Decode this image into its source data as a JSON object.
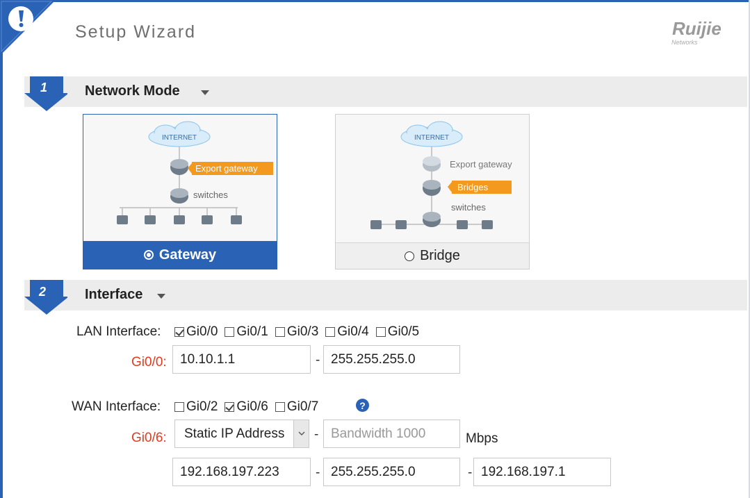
{
  "header": {
    "title": "Setup Wizard",
    "logo_text": "Ruijie",
    "logo_subtext": "Networks",
    "accent": "#2a63b6"
  },
  "section1": {
    "step": "1",
    "title": "Network Mode"
  },
  "section2": {
    "step": "2",
    "title": "Interface"
  },
  "modes": {
    "gateway": {
      "label": "Gateway",
      "selected": true,
      "diagram": {
        "cloud": "INTERNET",
        "export_gateway": "Export gateway",
        "switches": "switches"
      }
    },
    "bridge": {
      "label": "Bridge",
      "selected": false,
      "diagram": {
        "cloud": "INTERNET",
        "export_gateway": "Export gateway",
        "bridges": "Bridges",
        "switches": "switches"
      }
    }
  },
  "lan": {
    "label": "LAN Interface:",
    "ports": [
      {
        "name": "Gi0/0",
        "checked": true
      },
      {
        "name": "Gi0/1",
        "checked": false
      },
      {
        "name": "Gi0/3",
        "checked": false
      },
      {
        "name": "Gi0/4",
        "checked": false
      },
      {
        "name": "Gi0/5",
        "checked": false
      }
    ],
    "row_label": "Gi0/0:",
    "ip": "10.10.1.1",
    "separator": "-",
    "mask": "255.255.255.0"
  },
  "wan": {
    "label": "WAN Interface:",
    "ports": [
      {
        "name": "Gi0/2",
        "checked": false
      },
      {
        "name": "Gi0/6",
        "checked": true
      },
      {
        "name": "Gi0/7",
        "checked": false
      }
    ],
    "help": "?",
    "row_label": "Gi0/6:",
    "mode_select": "Static IP Address",
    "separator": "-",
    "bandwidth_placeholder": "Bandwidth 1000",
    "unit": "Mbps",
    "ip": "192.168.197.223",
    "mask": "255.255.255.0",
    "gateway": "192.168.197.1"
  }
}
